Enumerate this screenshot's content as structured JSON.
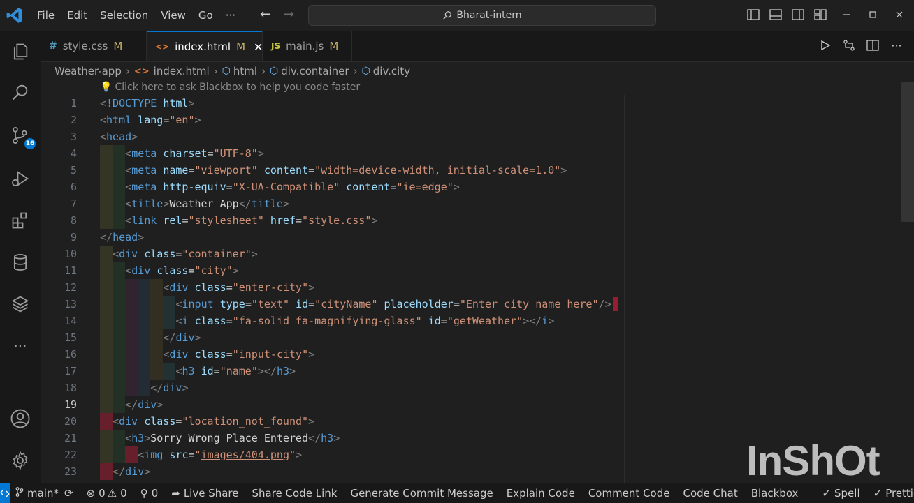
{
  "menu": [
    "File",
    "Edit",
    "Selection",
    "View",
    "Go",
    "···"
  ],
  "search": {
    "text": "Bharat-intern"
  },
  "activity": {
    "scm_badge": "16"
  },
  "tabs": [
    {
      "label": "style.css",
      "icon": "#",
      "status": "M",
      "active": false
    },
    {
      "label": "index.html",
      "icon": "<>",
      "status": "M",
      "active": true
    },
    {
      "label": "main.js",
      "icon": "JS",
      "status": "M",
      "active": false
    }
  ],
  "breadcrumb": {
    "folder": "Weather-app",
    "file": "index.html",
    "path": [
      "html",
      "div.container",
      "div.city"
    ]
  },
  "hint": "Click here to ask Blackbox to help you code faster",
  "code": {
    "current_line": "19",
    "lines": [
      {
        "n": "1",
        "text": "<!DOCTYPE html>"
      },
      {
        "n": "2",
        "text": "<html lang=\"en\">"
      },
      {
        "n": "3",
        "text": "<head>"
      },
      {
        "n": "4",
        "text": "<meta charset=\"UTF-8\">"
      },
      {
        "n": "5",
        "text": "<meta name=\"viewport\" content=\"width=device-width, initial-scale=1.0\">"
      },
      {
        "n": "6",
        "text": "<meta http-equiv=\"X-UA-Compatible\" content=\"ie=edge\">"
      },
      {
        "n": "7",
        "text": "<title>Weather App</title>"
      },
      {
        "n": "8",
        "text": "<link rel=\"stylesheet\" href=\"style.css\">"
      },
      {
        "n": "9",
        "text": "</head>"
      },
      {
        "n": "10",
        "text": "<div class=\"container\">"
      },
      {
        "n": "11",
        "text": "<div class=\"city\">"
      },
      {
        "n": "12",
        "text": "<div class=\"enter-city\">"
      },
      {
        "n": "13",
        "text": "<input type=\"text\" id=\"cityName\" placeholder=\"Enter city name here\"/>"
      },
      {
        "n": "14",
        "text": "<i class=\"fa-solid fa-magnifying-glass\" id=\"getWeather\"></i>"
      },
      {
        "n": "15",
        "text": "</div>"
      },
      {
        "n": "16",
        "text": "<div class=\"input-city\">"
      },
      {
        "n": "17",
        "text": "<h3 id=\"name\"></h3>"
      },
      {
        "n": "18",
        "text": "</div>"
      },
      {
        "n": "19",
        "text": "</div>"
      },
      {
        "n": "20",
        "text": "<div class=\"location_not_found\">"
      },
      {
        "n": "21",
        "text": "<h3>Sorry Wrong Place Entered</h3>"
      },
      {
        "n": "22",
        "text": "<img src=\"images/404.png\">"
      },
      {
        "n": "23",
        "text": "</div>"
      }
    ]
  },
  "status": {
    "branch": "main*",
    "errors": "0",
    "warnings": "0",
    "ports": "0",
    "live_share": "Live Share",
    "share_code_link": "Share Code Link",
    "generate_commit": "Generate Commit Message",
    "explain_code": "Explain Code",
    "comment_code": "Comment Code",
    "code_chat": "Code Chat",
    "blackbox": "Blackbox",
    "spell": "Spell",
    "prettier": "Prettier"
  },
  "watermark": "InShOt",
  "colors": {
    "accent": "#0078d4",
    "tag": "#569cd6",
    "attr": "#9cdcfe",
    "string": "#ce9178",
    "modified": "#c9b36b"
  }
}
